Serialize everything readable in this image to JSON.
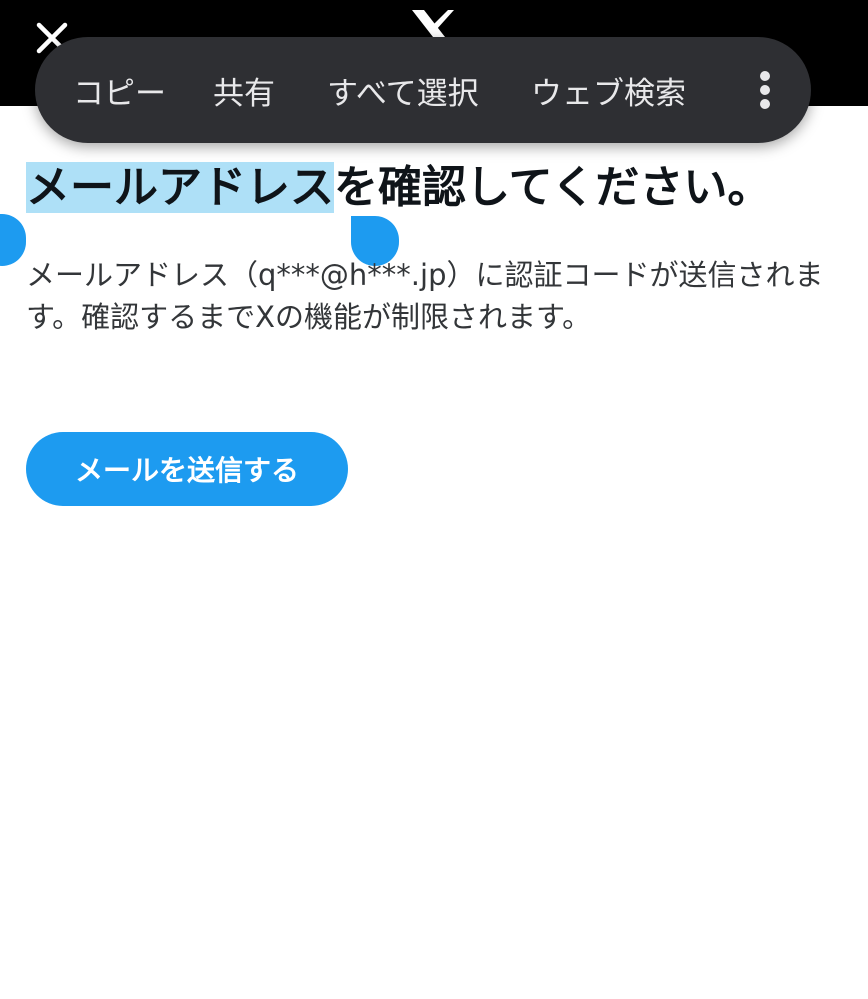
{
  "colors": {
    "topbar": "#000000",
    "menu_bg": "#2e2f33",
    "menu_text": "#e8e8ea",
    "selection_highlight": "#aee0f7",
    "accent": "#1d9bf0"
  },
  "header": {
    "close_icon": "close-icon",
    "logo_icon": "x-logo-icon"
  },
  "context_menu": {
    "items": [
      {
        "label": "コピー"
      },
      {
        "label": "共有"
      },
      {
        "label": "すべて選択"
      },
      {
        "label": "ウェブ検索"
      }
    ],
    "more_icon": "more-vertical-icon"
  },
  "main": {
    "heading_selected": "メールアドレス",
    "heading_rest": "を確認してください。",
    "description": "メールアドレス（q***@h***.jp）に認証コードが送信されます。確認するまでXの機能が制限されます。",
    "send_button": "メールを送信する"
  }
}
